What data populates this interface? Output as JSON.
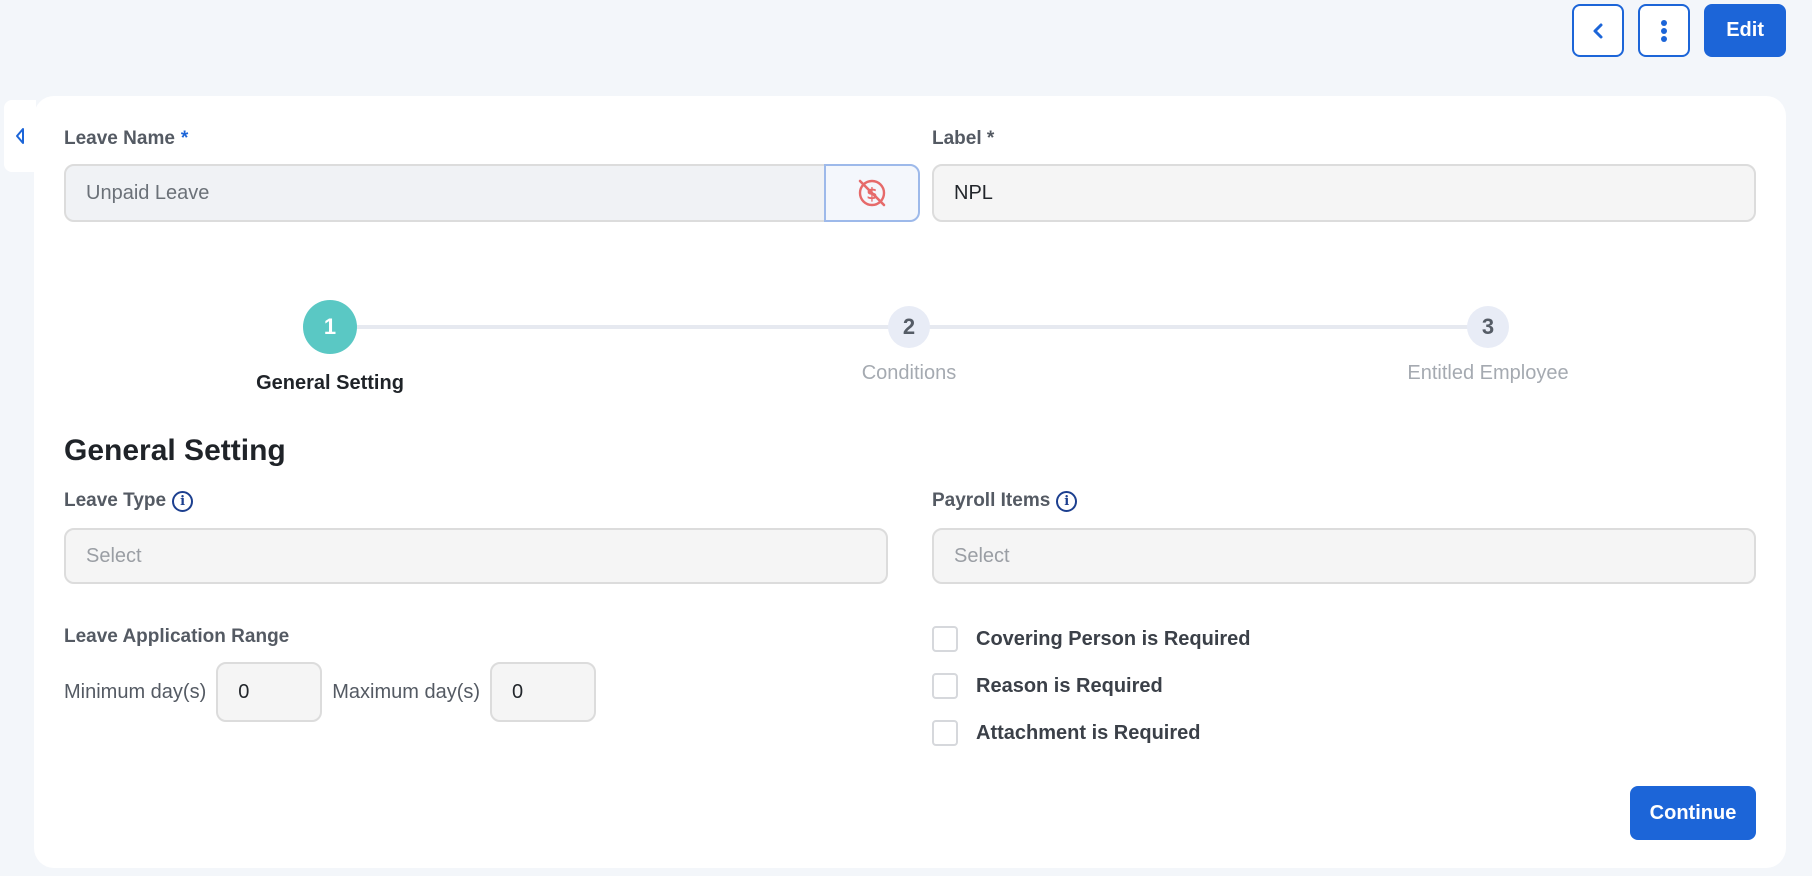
{
  "header": {
    "edit_label": "Edit",
    "back_icon": "chevron-left-icon",
    "more_icon": "more-vertical-icon"
  },
  "form": {
    "leave_name": {
      "label": "Leave Name",
      "required_mark": "*",
      "value": "Unpaid Leave",
      "toggle_icon": "no-pay-icon"
    },
    "label_field": {
      "label": "Label *",
      "value": "NPL"
    }
  },
  "stepper": {
    "steps": [
      {
        "number": "1",
        "label": "General Setting",
        "state": "active"
      },
      {
        "number": "2",
        "label": "Conditions",
        "state": "idle"
      },
      {
        "number": "3",
        "label": "Entitled Employee",
        "state": "idle"
      }
    ]
  },
  "general": {
    "title": "General Setting",
    "leave_type": {
      "label": "Leave Type",
      "placeholder": "Select"
    },
    "payroll_items": {
      "label": "Payroll Items",
      "placeholder": "Select"
    },
    "range": {
      "label": "Leave Application Range",
      "min_label": "Minimum day(s)",
      "min_value": "0",
      "max_label": "Maximum day(s)",
      "max_value": "0"
    },
    "checkboxes": [
      {
        "label": "Covering Person is Required",
        "checked": false
      },
      {
        "label": "Reason is Required",
        "checked": false
      },
      {
        "label": "Attachment is Required",
        "checked": false
      }
    ],
    "continue_label": "Continue"
  },
  "colors": {
    "primary": "#1c65d8",
    "step_active": "#5ac8c4",
    "toggle_icon": "#e66a6a"
  }
}
